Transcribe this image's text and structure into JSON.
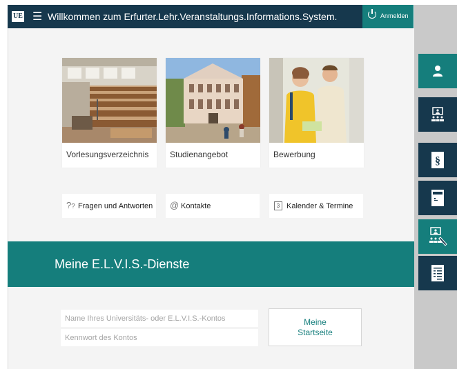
{
  "header": {
    "logo": "UE",
    "title": "Willkommen zum Erfurter.Lehr.Veranstaltungs.Informations.System.",
    "login_label": "Anmelden"
  },
  "tiles": [
    {
      "label": "Vorlesungsverzeichnis"
    },
    {
      "label": "Studienangebot"
    },
    {
      "label": "Bewerbung"
    }
  ],
  "links": [
    {
      "label": "Fragen und Antworten",
      "icon": "question-icon"
    },
    {
      "label": "Kontakte",
      "icon": "at-icon"
    },
    {
      "label": "Kalender & Termine",
      "icon": "calendar-icon",
      "icon_text": "3"
    }
  ],
  "services": {
    "title": "Meine E.L.V.I.S.-Dienste",
    "username_placeholder": "Name Ihres Universitäts- oder E.L.V.I.S.-Kontos",
    "password_placeholder": "Kennwort des Kontos",
    "start_line1": "Meine",
    "start_line2": "Startseite"
  },
  "sidebar": [
    {
      "icon": "user-icon"
    },
    {
      "icon": "lecture-icon"
    },
    {
      "icon": "paragraph-icon"
    },
    {
      "icon": "form-icon"
    },
    {
      "icon": "teaching-icon"
    },
    {
      "icon": "list-document-icon"
    }
  ],
  "colors": {
    "navy": "#16384d",
    "teal": "#157e7c",
    "background": "#f4f4f4"
  }
}
